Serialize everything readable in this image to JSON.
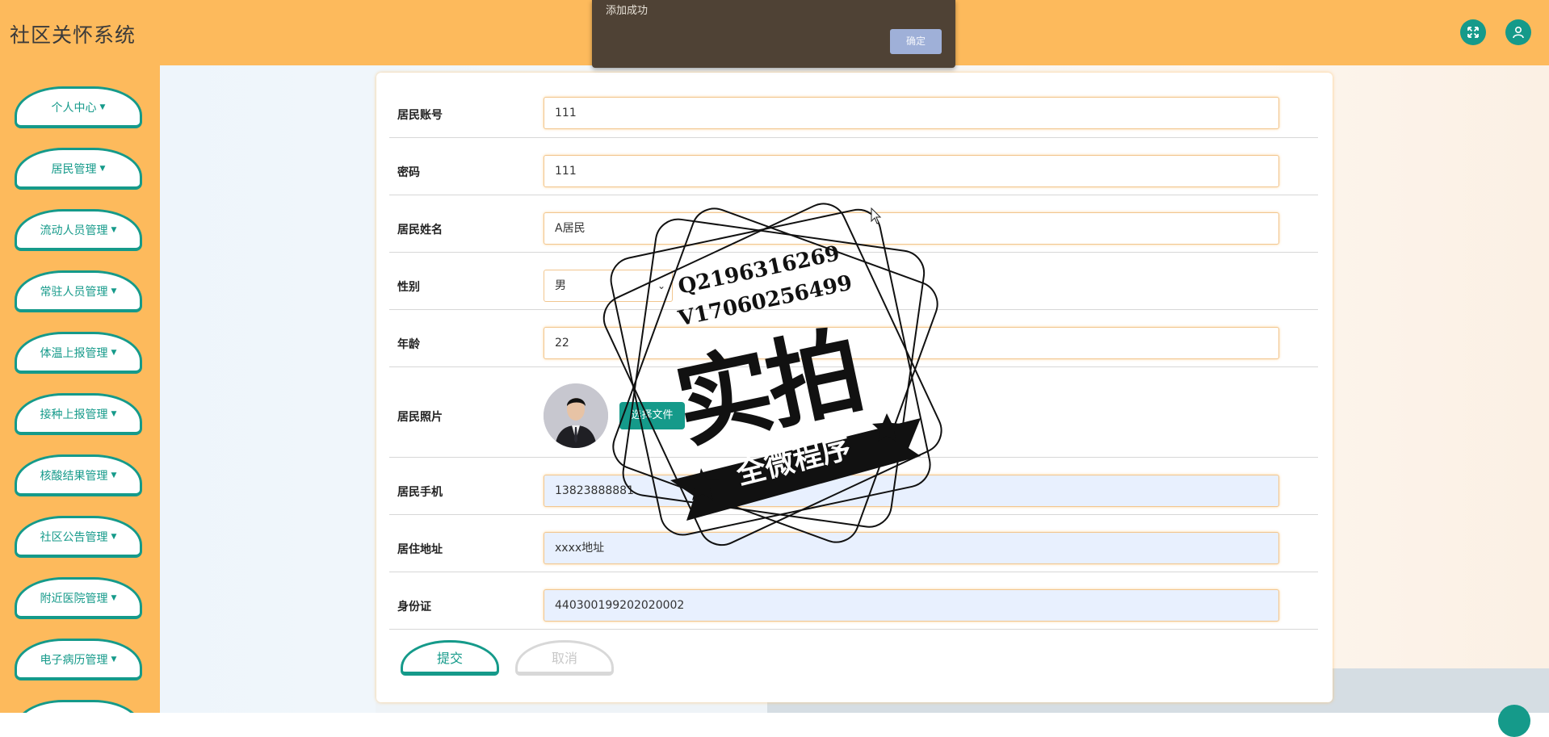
{
  "header": {
    "title": "社区关怀系统",
    "fullscreen_icon": "expand-icon",
    "user_icon": "user-icon"
  },
  "sidebar": {
    "items": [
      {
        "label": "个人中心"
      },
      {
        "label": "居民管理"
      },
      {
        "label": "流动人员管理"
      },
      {
        "label": "常驻人员管理"
      },
      {
        "label": "体温上报管理"
      },
      {
        "label": "接种上报管理"
      },
      {
        "label": "核酸结果管理"
      },
      {
        "label": "社区公告管理"
      },
      {
        "label": "附近医院管理"
      },
      {
        "label": "电子病历管理"
      }
    ]
  },
  "form": {
    "account": {
      "label": "居民账号",
      "value": "111"
    },
    "password": {
      "label": "密码",
      "value": "111"
    },
    "name": {
      "label": "居民姓名",
      "value": "A居民"
    },
    "gender": {
      "label": "性别",
      "value": "男"
    },
    "age": {
      "label": "年龄",
      "value": "22"
    },
    "photo": {
      "label": "居民照片",
      "upload_label": "选择文件"
    },
    "phone": {
      "label": "居民手机",
      "value": "13823888881"
    },
    "address": {
      "label": "居住地址",
      "value": "xxxx地址"
    },
    "idcard": {
      "label": "身份证",
      "value": "440300199202020002"
    },
    "submit_label": "提交",
    "cancel_label": "取消"
  },
  "toast": {
    "message": "添加成功",
    "ok_label": "确定"
  },
  "watermark": {
    "line1": "Q2196316269",
    "line2": "V17060256499",
    "big": "实拍",
    "banner": "全微程序"
  },
  "colors": {
    "accent": "#159a8a",
    "header_bg": "#fdba5c",
    "toast_bg": "#4f4235"
  }
}
